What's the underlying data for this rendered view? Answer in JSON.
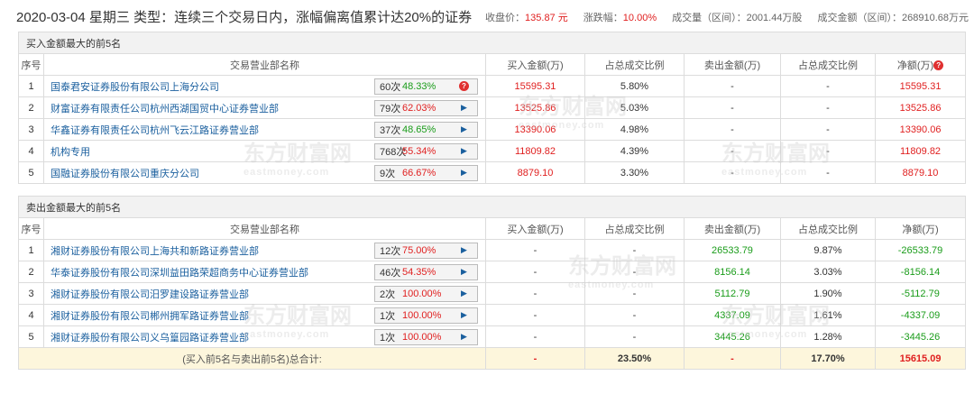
{
  "header": {
    "title": "2020-03-04 星期三  类型：连续三个交易日内，涨幅偏离值累计达20%的证券",
    "close_label": "收盘价：",
    "close_value": "135.87 元",
    "change_label": "涨跌幅：",
    "change_value": "10.00%",
    "volume": "成交量（区间）：2001.44万股",
    "amount": "成交金额（区间）：268910.68万元"
  },
  "buy_section": {
    "title": "买入金额最大的前5名",
    "columns": [
      "序号",
      "交易营业部名称",
      "买入金额(万)",
      "占总成交比例",
      "卖出金额(万)",
      "占总成交比例",
      "净额(万)"
    ],
    "rows": [
      {
        "idx": "1",
        "name": "国泰君安证券股份有限公司上海分公司",
        "count": "60次",
        "pct": "48.33%",
        "buy": "15595.31",
        "buy_ratio": "5.80%",
        "sell": "-",
        "sell_ratio": "-",
        "net": "15595.31"
      },
      {
        "idx": "2",
        "name": "财富证券有限责任公司杭州西湖国贸中心证券营业部",
        "count": "79次",
        "pct": "62.03%",
        "buy": "13525.86",
        "buy_ratio": "5.03%",
        "sell": "-",
        "sell_ratio": "-",
        "net": "13525.86"
      },
      {
        "idx": "3",
        "name": "华鑫证券有限责任公司杭州飞云江路证券营业部",
        "count": "37次",
        "pct": "48.65%",
        "buy": "13390.06",
        "buy_ratio": "4.98%",
        "sell": "-",
        "sell_ratio": "-",
        "net": "13390.06"
      },
      {
        "idx": "4",
        "name": "机构专用",
        "count": "768次",
        "pct": "55.34%",
        "buy": "11809.82",
        "buy_ratio": "4.39%",
        "sell": "-",
        "sell_ratio": "-",
        "net": "11809.82"
      },
      {
        "idx": "5",
        "name": "国融证券股份有限公司重庆分公司",
        "count": "9次",
        "pct": "66.67%",
        "buy": "8879.10",
        "buy_ratio": "3.30%",
        "sell": "-",
        "sell_ratio": "-",
        "net": "8879.10"
      }
    ]
  },
  "sell_section": {
    "title": "卖出金额最大的前5名",
    "columns": [
      "序号",
      "交易营业部名称",
      "买入金额(万)",
      "占总成交比例",
      "卖出金额(万)",
      "占总成交比例",
      "净额(万)"
    ],
    "rows": [
      {
        "idx": "1",
        "name": "湘财证券股份有限公司上海共和新路证券营业部",
        "count": "12次",
        "pct": "75.00%",
        "buy": "-",
        "buy_ratio": "-",
        "sell": "26533.79",
        "sell_ratio": "9.87%",
        "net": "-26533.79"
      },
      {
        "idx": "2",
        "name": "华泰证券股份有限公司深圳益田路荣超商务中心证券营业部",
        "count": "46次",
        "pct": "54.35%",
        "buy": "-",
        "buy_ratio": "-",
        "sell": "8156.14",
        "sell_ratio": "3.03%",
        "net": "-8156.14"
      },
      {
        "idx": "3",
        "name": "湘财证券股份有限公司汨罗建设路证券营业部",
        "count": "2次",
        "pct": "100.00%",
        "buy": "-",
        "buy_ratio": "-",
        "sell": "5112.79",
        "sell_ratio": "1.90%",
        "net": "-5112.79"
      },
      {
        "idx": "4",
        "name": "湘财证券股份有限公司郴州拥军路证券营业部",
        "count": "1次",
        "pct": "100.00%",
        "buy": "-",
        "buy_ratio": "-",
        "sell": "4337.09",
        "sell_ratio": "1.61%",
        "net": "-4337.09"
      },
      {
        "idx": "5",
        "name": "湘财证券股份有限公司义乌篁园路证券营业部",
        "count": "1次",
        "pct": "100.00%",
        "buy": "-",
        "buy_ratio": "-",
        "sell": "3445.26",
        "sell_ratio": "1.28%",
        "net": "-3445.26"
      }
    ]
  },
  "total": {
    "label": "(买入前5名与卖出前5名)总合计:",
    "buy": "-",
    "buy_ratio": "23.50%",
    "sell": "-",
    "sell_ratio": "17.70%",
    "net": "15615.09"
  },
  "watermark": {
    "cn": "东方财富网",
    "en": "eastmoney.com"
  },
  "icons": {
    "question": "question-badge-icon",
    "arrow": "play-arrow-icon"
  }
}
